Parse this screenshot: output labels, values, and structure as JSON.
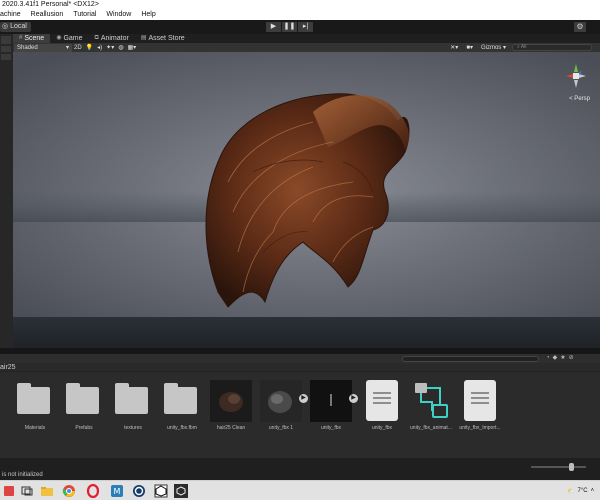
{
  "window": {
    "title": "2020.3.41f1 Personal* <DX12>"
  },
  "menu": [
    "achine",
    "Reallusion",
    "Tutorial",
    "Window",
    "Help"
  ],
  "toolbar": {
    "local_label": "Local",
    "play_icons": [
      "play-icon",
      "pause-icon",
      "step-icon"
    ]
  },
  "tabs": [
    {
      "label": "Scene",
      "icon": "hash-icon",
      "active": true
    },
    {
      "label": "Game",
      "icon": "gamepad-icon",
      "active": false
    },
    {
      "label": "Animator",
      "icon": "animator-icon",
      "active": false
    },
    {
      "label": "Asset Store",
      "icon": "store-icon",
      "active": false
    }
  ],
  "scene_toolbar": {
    "shading_mode": "Shaded",
    "mode_2d": "2D",
    "gizmos_label": "Gizmos",
    "search_placeholder": "All"
  },
  "viewport": {
    "perspective_label": "< Persp"
  },
  "project": {
    "breadcrumb": "air25",
    "assets": [
      {
        "label": "Materials",
        "kind": "folder"
      },
      {
        "label": "Prefabs",
        "kind": "folder"
      },
      {
        "label": "textures",
        "kind": "folder"
      },
      {
        "label": "unity_fbx.fbm",
        "kind": "folder"
      },
      {
        "label": "hair25 Clean",
        "kind": "model-thumb"
      },
      {
        "label": "unity_fbx 1",
        "kind": "model-thumb"
      },
      {
        "label": "unity_fbx",
        "kind": "model-thumb"
      },
      {
        "label": "unity_fbx",
        "kind": "document"
      },
      {
        "label": "unity_fbx_animat...",
        "kind": "animator-controller"
      },
      {
        "label": "unity_fbx_Import...",
        "kind": "document"
      }
    ]
  },
  "status": {
    "text": "is not initialized",
    "icon_size": 0.75
  },
  "taskbar": {
    "temperature": "7°C",
    "icons": [
      "app-icon",
      "explorer-icon",
      "chrome-icon",
      "opera-icon",
      "media-icon",
      "cinema4d-icon",
      "unity-icon",
      "unity-editor-icon"
    ]
  },
  "colors": {
    "editor_bg": "#1f1f1f",
    "panel_bg": "#2b2b2b",
    "hair": "#7a3a1e",
    "gizmo_green": "#6ec33b",
    "gizmo_red": "#d24a3a",
    "gizmo_blue": "#4a7bd2"
  }
}
